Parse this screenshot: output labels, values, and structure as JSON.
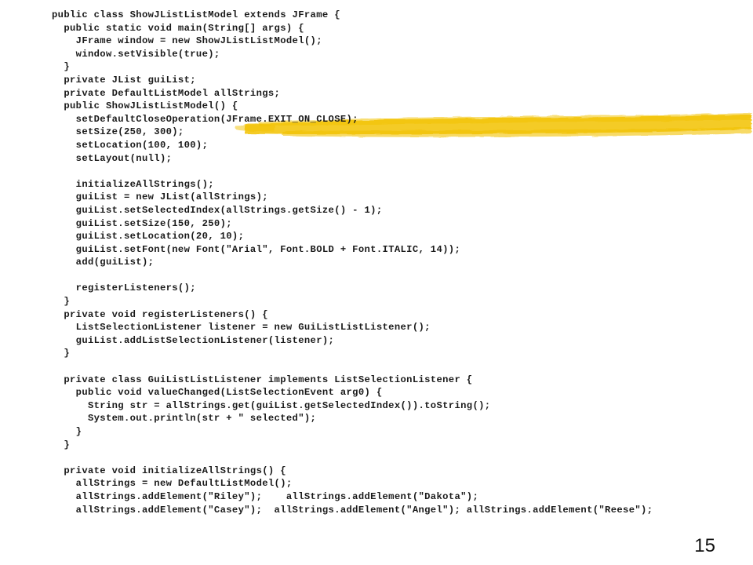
{
  "code_lines": [
    "public class ShowJListListModel extends JFrame {",
    "  public static void main(String[] args) {",
    "    JFrame window = new ShowJListListModel();",
    "    window.setVisible(true);",
    "  }",
    "  private JList guiList;",
    "  private DefaultListModel allStrings;",
    "  public ShowJListListModel() {",
    "    setDefaultCloseOperation(JFrame.EXIT_ON_CLOSE);",
    "    setSize(250, 300);",
    "    setLocation(100, 100);",
    "    setLayout(null);",
    "",
    "    initializeAllStrings();",
    "    guiList = new JList(allStrings);",
    "    guiList.setSelectedIndex(allStrings.getSize() - 1);",
    "    guiList.setSize(150, 250);",
    "    guiList.setLocation(20, 10);",
    "    guiList.setFont(new Font(\"Arial\", Font.BOLD + Font.ITALIC, 14));",
    "    add(guiList);",
    "",
    "    registerListeners();",
    "  }",
    "  private void registerListeners() {",
    "    ListSelectionListener listener = new GuiListListListener();",
    "    guiList.addListSelectionListener(listener);",
    "  }",
    "",
    "  private class GuiListListListener implements ListSelectionListener {",
    "    public void valueChanged(ListSelectionEvent arg0) {",
    "      String str = allStrings.get(guiList.getSelectedIndex()).toString();",
    "      System.out.println(str + \" selected\");",
    "    }",
    "  }",
    "",
    "  private void initializeAllStrings() {",
    "    allStrings = new DefaultListModel();",
    "    allStrings.addElement(\"Riley\");    allStrings.addElement(\"Dakota\");",
    "    allStrings.addElement(\"Casey\");  allStrings.addElement(\"Angel\"); allStrings.addElement(\"Reese\");"
  ],
  "slide_number": "15",
  "highlight_color": "#f2c200"
}
